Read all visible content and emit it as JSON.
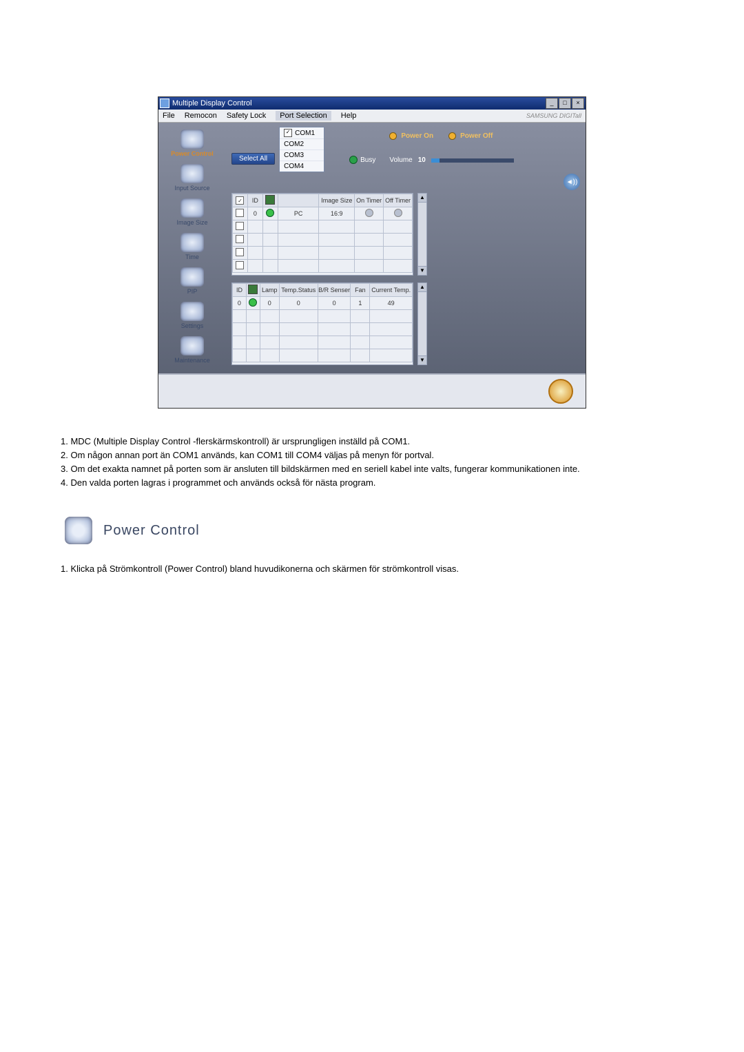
{
  "app": {
    "title": "Multiple Display Control",
    "brand": "SAMSUNG DIGITall"
  },
  "menu": {
    "file": "File",
    "remocon": "Remocon",
    "safety": "Safety Lock",
    "port": "Port Selection",
    "help": "Help"
  },
  "port_options": [
    "COM1",
    "COM2",
    "COM3",
    "COM4"
  ],
  "select_all": "Select All",
  "busy_label": "Busy",
  "sidebar": [
    {
      "label": "Power Control",
      "active": true
    },
    {
      "label": "Input Source"
    },
    {
      "label": "Image Size"
    },
    {
      "label": "Time"
    },
    {
      "label": "PIP"
    },
    {
      "label": "Settings"
    },
    {
      "label": "Maintenance"
    }
  ],
  "grid1": {
    "headers": [
      "",
      "ID",
      "",
      "",
      "Image Size",
      "On Timer",
      "Off Timer"
    ],
    "row": {
      "id": "0",
      "source": "PC",
      "imagesize": "16:9"
    }
  },
  "grid2": {
    "headers": [
      "ID",
      "",
      "Lamp",
      "Temp.Status",
      "B/R Senser",
      "Fan",
      "Current Temp."
    ],
    "row": {
      "id": "0",
      "lamp": "0",
      "temp_status": "0",
      "br": "0",
      "fan": "1",
      "cur": "49"
    }
  },
  "power": {
    "on": "Power On",
    "off": "Power Off",
    "volume_label": "Volume",
    "volume_value": "10"
  },
  "doc": {
    "list1": [
      "1.  MDC (Multiple Display Control -flerskärmskontroll) är ursprungligen inställd på COM1.",
      "2.  Om någon annan port än COM1 används, kan COM1 till COM4 väljas på menyn för portval.",
      "3.  Om det exakta namnet på porten som är ansluten till bildskärmen med en seriell kabel inte valts, fungerar kommunikationen inte.",
      "4.  Den valda porten lagras i programmet och används också för nästa program."
    ],
    "section_title": "Power Control",
    "list2": [
      "1.  Klicka på Strömkontroll (Power Control) bland huvudikonerna och skärmen för strömkontroll visas."
    ]
  }
}
